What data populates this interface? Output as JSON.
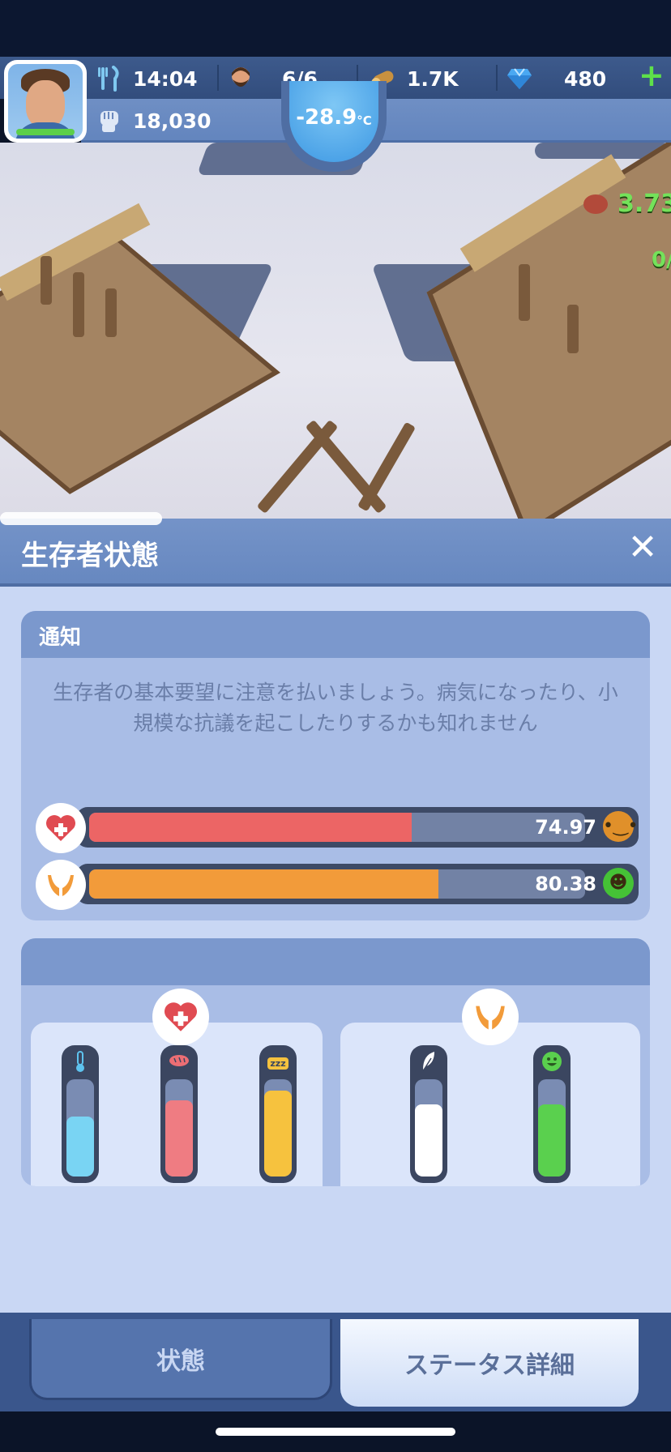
{
  "hud": {
    "food_time": "14:04",
    "survivors": "6/6",
    "wood": "1.7K",
    "gems": "480",
    "power": "18,030",
    "temperature": "-28.9",
    "temperature_unit": "°C"
  },
  "scene": {
    "labels": [
      "3.73",
      "0/"
    ]
  },
  "panel": {
    "title": "生存者状態",
    "notice": {
      "title": "通知",
      "text": "生存者の基本要望に注意を払いましょう。病気になったり、小規模な抗議を起こしたりするかも知れません"
    },
    "bars": [
      {
        "name": "health",
        "value": "74.97",
        "fill": 0.6497,
        "color": "#ec6565",
        "face_color": "#e0902a",
        "face": "😐"
      },
      {
        "name": "happiness",
        "value": "80.38",
        "fill": 0.7038,
        "color": "#f29b3a",
        "face_color": "#45c236",
        "face": "☻"
      }
    ],
    "health_needs": [
      {
        "name": "warmth",
        "icon": "thermometer",
        "fill": 0.62,
        "color": "#79d4f3",
        "icon_color": "#5ec3ef"
      },
      {
        "name": "food",
        "icon": "bread",
        "fill": 0.78,
        "color": "#ef7c82",
        "icon_color": "#ec6e74"
      },
      {
        "name": "rest",
        "icon": "zzz",
        "fill": 0.88,
        "color": "#f6c23e",
        "icon_color": "#f6c23e"
      }
    ],
    "happiness_needs": [
      {
        "name": "comfort",
        "icon": "feather",
        "fill": 0.74,
        "color": "#ffffff",
        "icon_color": "#ffffff"
      },
      {
        "name": "mood",
        "icon": "smile",
        "fill": 0.74,
        "color": "#5ad04e",
        "icon_color": "#5ad04e"
      }
    ]
  },
  "tabs": {
    "left": "状態",
    "right": "ステータス詳細"
  },
  "colors": {
    "health": "#ec6565",
    "happiness": "#f29b3a",
    "panel_bg": "#c9d7f4",
    "header": "#6788c0"
  }
}
